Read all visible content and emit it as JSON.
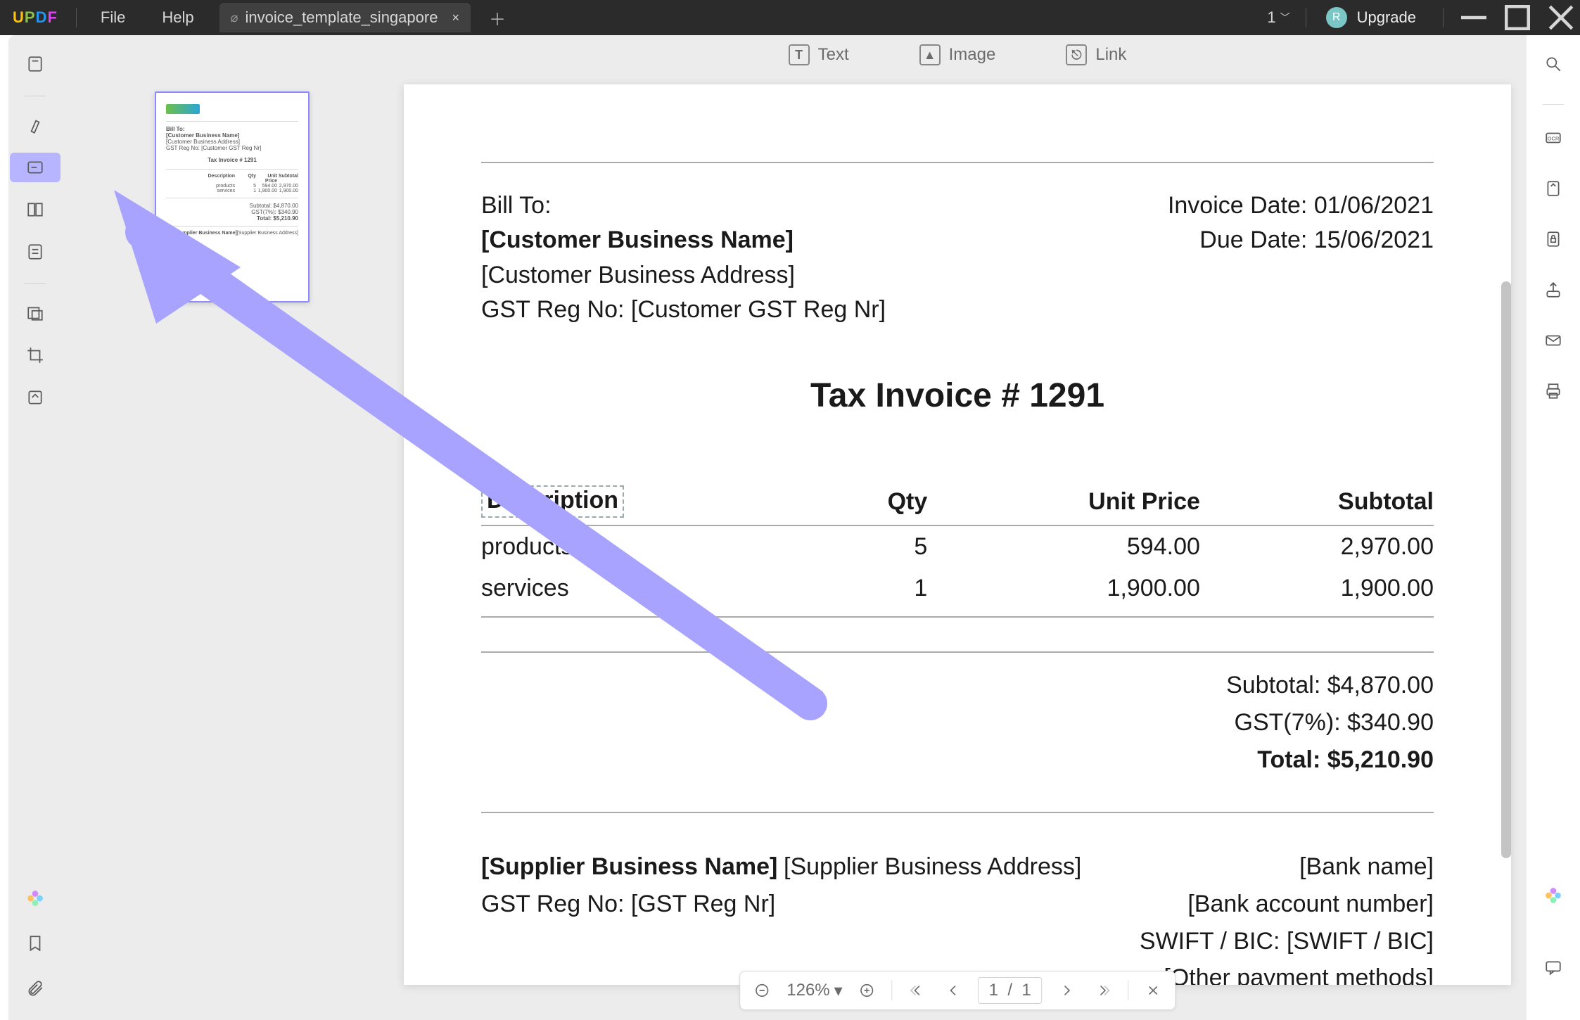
{
  "titlebar": {
    "menu_file": "File",
    "menu_help": "Help",
    "tab_name": "invoice_template_singapore",
    "page_count": "1",
    "avatar_initial": "R",
    "upgrade": "Upgrade"
  },
  "doc_toolbar": {
    "text": "Text",
    "image": "Image",
    "link": "Link"
  },
  "invoice": {
    "bill_to_label": "Bill To:",
    "customer_name": "[Customer Business Name]",
    "customer_address": "[Customer Business Address]",
    "customer_gst": "GST Reg No: [Customer GST Reg Nr]",
    "invoice_date_label": "Invoice Date: ",
    "invoice_date": "01/06/2021",
    "due_date_label": "Due Date: ",
    "due_date": "15/06/2021",
    "title": "Tax Invoice # 1291",
    "thumb_title": "Tax Invoice # 1291",
    "cols": {
      "desc": "Description",
      "qty": "Qty",
      "unit": "Unit Price",
      "sub": "Subtotal"
    },
    "rows": [
      {
        "desc": "products",
        "qty": "5",
        "unit": "594.00",
        "sub": "2,970.00"
      },
      {
        "desc": "services",
        "qty": "1",
        "unit": "1,900.00",
        "sub": "1,900.00"
      }
    ],
    "subtotal_label": "Subtotal: ",
    "subtotal": "$4,870.00",
    "gst_label": "GST(7%): ",
    "gst": "$340.90",
    "total_label": "Total: ",
    "total": "$5,210.90",
    "supplier_name": "[Supplier Business Name]",
    "supplier_gst": "GST Reg No: [GST Reg Nr]",
    "supplier_address": "[Supplier Business Address]",
    "bank_name": "[Bank name]",
    "bank_acct": "[Bank account number]",
    "swift": "SWIFT / BIC: [SWIFT / BIC]",
    "other": "[Other payment methods]"
  },
  "statusbar": {
    "zoom": "126%",
    "page_cur": "1",
    "page_sep": "/",
    "page_total": "1"
  }
}
